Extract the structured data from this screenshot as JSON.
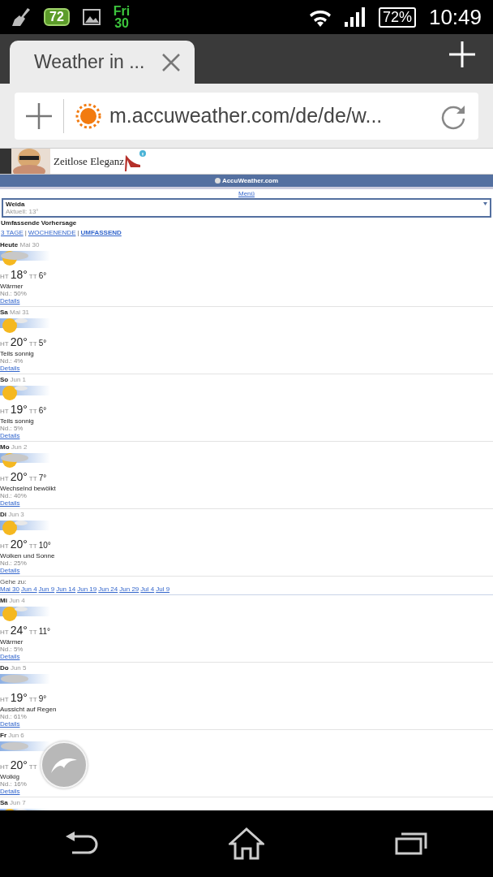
{
  "status_bar": {
    "notification_badge": "72",
    "day": "Fri",
    "date": "30",
    "battery": "72%",
    "time": "10:49"
  },
  "browser": {
    "tab": {
      "title": "Weather in ...",
      "selected": true
    },
    "url": "m.accuweather.com/de/de/w..."
  },
  "ad": {
    "text": "Zeitlose Eleganz"
  },
  "site": {
    "brand": "AccuWeather.com",
    "menu": "Menü"
  },
  "location": {
    "name": "Weida",
    "current": "Aktuell: 13°"
  },
  "heading": "Umfassende Vorhersage",
  "views": [
    {
      "label": "3 TAGE",
      "selected": false
    },
    {
      "label": "WOCHENENDE",
      "selected": false
    },
    {
      "label": "UMFASSEND",
      "selected": true
    }
  ],
  "view_separators": [
    "|",
    "|"
  ],
  "days": [
    {
      "day": "Heute",
      "date": "Mai 30",
      "kind": "partly",
      "high_label": "HT",
      "high": "18°",
      "low_label": "TT",
      "low": "6°",
      "condition": "Wärmer",
      "precip_label": "Nd.:",
      "precip": "50%",
      "link": "Details"
    },
    {
      "day": "Sa",
      "date": "Mai 31",
      "kind": "sun",
      "high_label": "HT",
      "high": "20°",
      "low_label": "TT",
      "low": "5°",
      "condition": "Teils sonnig",
      "precip_label": "Nd.:",
      "precip": "4%",
      "link": "Details"
    },
    {
      "day": "So",
      "date": "Jun 1",
      "kind": "sun",
      "high_label": "HT",
      "high": "19°",
      "low_label": "TT",
      "low": "6°",
      "condition": "Teils sonnig",
      "precip_label": "Nd.:",
      "precip": "5%",
      "link": "Details"
    },
    {
      "day": "Mo",
      "date": "Jun 2",
      "kind": "partly",
      "high_label": "HT",
      "high": "20°",
      "low_label": "TT",
      "low": "7°",
      "condition": "Wechselnd bewölkt",
      "precip_label": "Nd.:",
      "precip": "40%",
      "link": "Details"
    },
    {
      "day": "Di",
      "date": "Jun 3",
      "kind": "sun",
      "high_label": "HT",
      "high": "20°",
      "low_label": "TT",
      "low": "10°",
      "condition": "Wolken und Sonne",
      "precip_label": "Nd.:",
      "precip": "25%",
      "link": "Details"
    }
  ],
  "goto": {
    "label": "Gehe zu:",
    "links": [
      "Mai 30",
      "Jun 4",
      "Jun 9",
      "Jun 14",
      "Jun 19",
      "Jun 24",
      "Jun 29",
      "Jul 4",
      "Jul 9"
    ]
  },
  "days_2": [
    {
      "day": "Mi",
      "date": "Jun 4",
      "kind": "sun",
      "high_label": "HT",
      "high": "24°",
      "low_label": "TT",
      "low": "11°",
      "condition": "Wärmer",
      "precip_label": "Nd.:",
      "precip": "5%",
      "link": "Details"
    },
    {
      "day": "Do",
      "date": "Jun 5",
      "kind": "cloud",
      "high_label": "HT",
      "high": "19°",
      "low_label": "TT",
      "low": "9°",
      "condition": "Aussicht auf Regen",
      "precip_label": "Nd.:",
      "precip": "61%",
      "link": "Details"
    },
    {
      "day": "Fr",
      "date": "Jun 6",
      "kind": "cloud",
      "high_label": "HT",
      "high": "20°",
      "low_label": "TT",
      "condition": "Wolkig",
      "precip_label": "Nd.:",
      "precip": "16%",
      "link": "Details"
    },
    {
      "day": "Sa",
      "date": "Jun 7",
      "kind": "sun"
    }
  ]
}
